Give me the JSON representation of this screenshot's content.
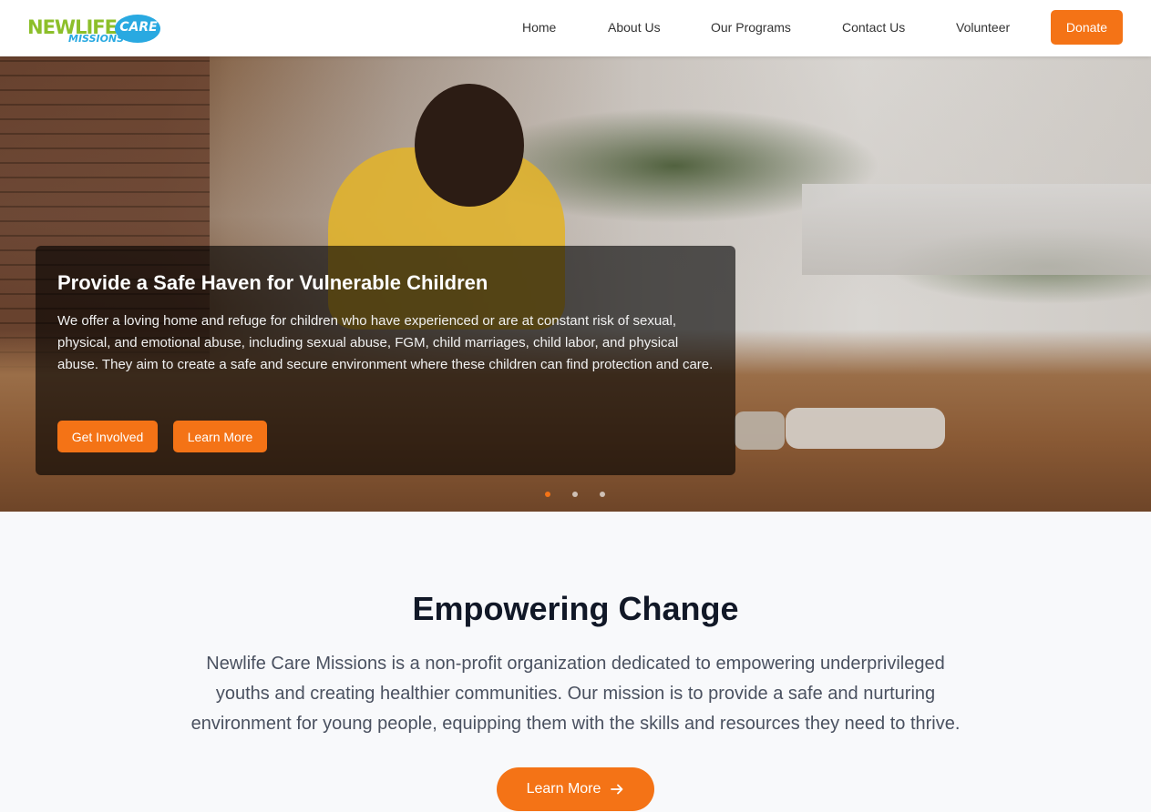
{
  "brand": {
    "logo_newlife": "NEWLIFE",
    "logo_care": "CARE",
    "logo_missions": "MISSIONS"
  },
  "nav": {
    "items": [
      {
        "label": "Home"
      },
      {
        "label": "About Us"
      },
      {
        "label": "Our Programs"
      },
      {
        "label": "Contact Us"
      },
      {
        "label": "Volunteer"
      }
    ],
    "donate_label": "Donate"
  },
  "hero": {
    "title": "Provide a Safe Haven for Vulnerable Children",
    "body": "We offer a loving home and refuge for children who have experienced or are at constant risk of sexual, physical, and emotional abuse, including sexual abuse, FGM, child marriages, child labor, and physical abuse. They aim to create a safe and secure environment where these children can find protection and care.",
    "primary_button": "Get Involved",
    "secondary_button": "Learn More",
    "slide_count": 3,
    "active_slide": 1
  },
  "intro": {
    "heading": "Empowering Change",
    "body": "Newlife Care Missions is a non-profit organization dedicated to empowering underprivileged youths and creating healthier communities. Our mission is to provide a safe and nurturing environment for young people, equipping them with the skills and resources they need to thrive.",
    "button_label": "Learn More",
    "button_icon": "arrow-right-icon"
  },
  "colors": {
    "accent": "#f47316",
    "logo_green": "#8cbf2a",
    "logo_blue": "#29a9e1"
  }
}
